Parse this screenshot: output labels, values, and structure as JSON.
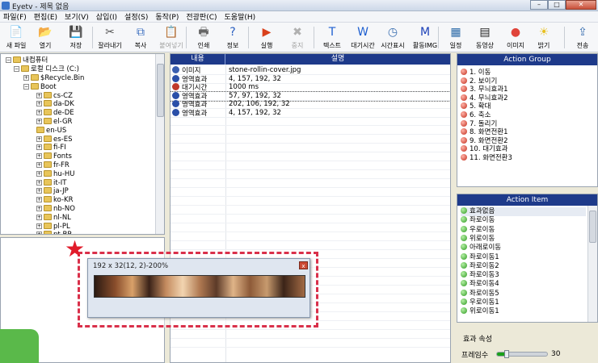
{
  "window": {
    "title": "Eyetv - 제목 없음"
  },
  "menu": [
    "파일(F)",
    "편집(E)",
    "보기(V)",
    "삽입(I)",
    "설정(S)",
    "동작(P)",
    "전광판(C)",
    "도움말(H)"
  ],
  "toolbar": [
    {
      "label": "새 파일",
      "icon": "new-file-icon",
      "glyph": "📄",
      "enabled": true
    },
    {
      "label": "열기",
      "icon": "open-folder-icon",
      "glyph": "📂",
      "enabled": true
    },
    {
      "label": "저장",
      "icon": "save-icon",
      "glyph": "💾",
      "enabled": true
    },
    {
      "label": "잘라내기",
      "icon": "cut-icon",
      "glyph": "✂",
      "enabled": true
    },
    {
      "label": "복사",
      "icon": "copy-icon",
      "glyph": "⧉",
      "enabled": true
    },
    {
      "label": "붙여넣기",
      "icon": "paste-icon",
      "glyph": "📋",
      "enabled": false
    },
    {
      "label": "인쇄",
      "icon": "print-icon",
      "glyph": "🖶",
      "enabled": true
    },
    {
      "label": "정보",
      "icon": "info-icon",
      "glyph": "?",
      "enabled": true
    },
    {
      "label": "실행",
      "icon": "play-icon",
      "glyph": "▶",
      "enabled": true
    },
    {
      "label": "중지",
      "icon": "stop-icon",
      "glyph": "✖",
      "enabled": false
    },
    {
      "label": "텍스트",
      "icon": "text-icon",
      "glyph": "T",
      "enabled": true
    },
    {
      "label": "대기시간",
      "icon": "wait-time-icon",
      "glyph": "W",
      "enabled": true
    },
    {
      "label": "시간표시",
      "icon": "clock-display-icon",
      "glyph": "◷",
      "enabled": true
    },
    {
      "label": "활동IMG",
      "icon": "activity-image-icon",
      "glyph": "M",
      "enabled": true
    },
    {
      "label": "일정",
      "icon": "schedule-icon",
      "glyph": "▦",
      "enabled": true
    },
    {
      "label": "동영상",
      "icon": "video-icon",
      "glyph": "▤",
      "enabled": true
    },
    {
      "label": "이미지",
      "icon": "image-icon",
      "glyph": "●",
      "enabled": true
    },
    {
      "label": "밝기",
      "icon": "brightness-icon",
      "glyph": "☀",
      "enabled": true
    },
    {
      "label": "전송",
      "icon": "send-icon",
      "glyph": "⇪",
      "enabled": true
    }
  ],
  "tree": {
    "root": "내컴퓨터",
    "drive": "로컬 디스크 (C:)",
    "items": [
      "$Recycle.Bin",
      "Boot",
      "cs-CZ",
      "da-DK",
      "de-DE",
      "el-GR",
      "en-US",
      "es-ES",
      "fi-FI",
      "Fonts",
      "fr-FR",
      "hu-HU",
      "it-IT",
      "ja-JP",
      "ko-KR",
      "nb-NO",
      "nl-NL",
      "pl-PL",
      "pt-BR"
    ]
  },
  "table": {
    "headers": [
      "내용",
      "설명"
    ],
    "rows": [
      {
        "type": "이미지",
        "desc": "stone-rollin-cover.jpg",
        "color": "#3a5fb0"
      },
      {
        "type": "영역효과",
        "desc": "4, 157, 192, 32",
        "color": "#2a4fa8"
      },
      {
        "type": "대기시간",
        "desc": "1000 ms",
        "color": "#c0392b"
      },
      {
        "type": "영역효과",
        "desc": "57, 97, 192, 32",
        "color": "#2a4fa8"
      },
      {
        "type": "영역효과",
        "desc": "202, 106, 192, 32",
        "color": "#2a4fa8"
      },
      {
        "type": "영역효과",
        "desc": "4, 157, 192, 32",
        "color": "#2a4fa8"
      }
    ]
  },
  "action_group": {
    "title": "Action Group",
    "items": [
      "1. 이동",
      "2. 보이기",
      "3. 무늬효과1",
      "4. 무늬효과2",
      "5. 확대",
      "6. 축소",
      "7. 돌리기",
      "8. 화면전환1",
      "9. 화면전환2",
      "10. 대기효과",
      "11. 화면전환3"
    ]
  },
  "action_item": {
    "title": "Action Item",
    "items": [
      "효과없음",
      "좌로이동",
      "우로이동",
      "위로이동",
      "아래로이동",
      "좌로이동1",
      "좌로이동2",
      "좌로이동3",
      "좌로이동4",
      "좌로이동5",
      "우로이동1",
      "위로이동1"
    ]
  },
  "properties": {
    "effect_label": "효과 속성",
    "frame_label": "프레임수",
    "frame_value": "30",
    "frame_fraction": 0.2
  },
  "popup": {
    "title": "192 x 32(12, 2)-200%",
    "close": "x"
  }
}
